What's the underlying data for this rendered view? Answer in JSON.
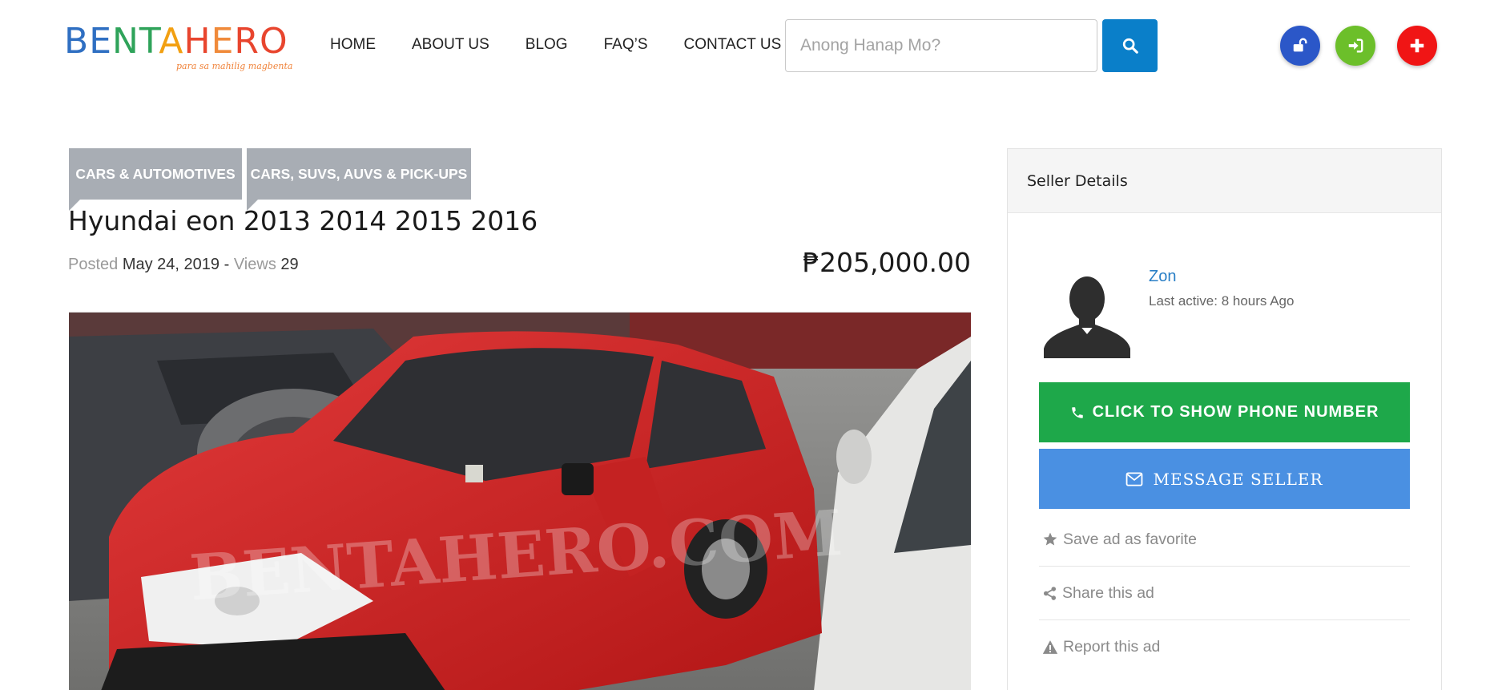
{
  "brand": {
    "logo_text": "BENTAHERO",
    "tagline": "para sa mahilig magbenta",
    "logo_letter_colors": [
      "#2f6fc2",
      "#2f6fc2",
      "#2fa35a",
      "#2fa35a",
      "#f2a012",
      "#e8452e",
      "#f08a3a",
      "#e8452e",
      "#e8452e"
    ]
  },
  "nav": {
    "items": [
      {
        "label": "HOME"
      },
      {
        "label": "ABOUT US"
      },
      {
        "label": "BLOG"
      },
      {
        "label": "FAQ’S"
      },
      {
        "label": "CONTACT US"
      }
    ]
  },
  "search": {
    "placeholder": "Anong Hanap Mo?",
    "value": ""
  },
  "header_buttons": [
    {
      "icon": "unlock-icon",
      "color": "#2b57c8"
    },
    {
      "icon": "sign-in-icon",
      "color": "#6cbf2a"
    },
    {
      "icon": "plus-icon",
      "color": "#f01515"
    }
  ],
  "listing": {
    "categories": [
      "CARS & AUTOMOTIVES",
      "CARS, SUVS, AUVS & PICK-UPS"
    ],
    "title": "Hyundai eon 2013 2014 2015 2016",
    "posted_label": "Posted",
    "posted_date": "May 24, 2019",
    "separator": "-",
    "views_label": "Views",
    "views": "29",
    "price": "₱205,000.00",
    "watermark": "BENTAHERO.COM"
  },
  "seller": {
    "panel_title": "Seller Details",
    "name": "Zon",
    "last_active": "Last active: 8 hours Ago",
    "phone_button": "CLICK TO SHOW PHONE NUMBER",
    "message_button": "MESSAGE SELLER",
    "actions": [
      {
        "label": "Save ad as favorite",
        "icon": "star-icon"
      },
      {
        "label": "Share this ad",
        "icon": "share-icon"
      },
      {
        "label": "Report this ad",
        "icon": "warning-icon"
      }
    ]
  },
  "colors": {
    "search_button": "#0a7fc9",
    "category_badge": "#a8adb4",
    "phone_button": "#1ea84a",
    "message_button": "#4a90e2",
    "seller_link": "#2a7fc6"
  }
}
